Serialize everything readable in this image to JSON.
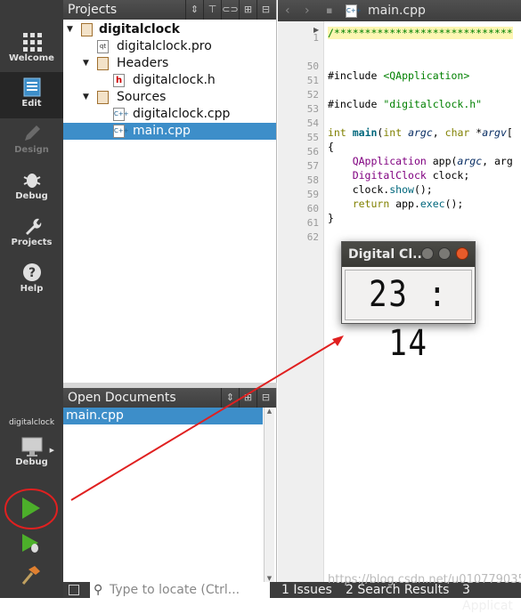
{
  "modes": [
    {
      "label": "Welcome",
      "icon": "grid-icon",
      "state": "normal"
    },
    {
      "label": "Edit",
      "icon": "document-icon",
      "state": "selected"
    },
    {
      "label": "Design",
      "icon": "pencil-icon",
      "state": "disabled"
    },
    {
      "label": "Debug",
      "icon": "bug-icon",
      "state": "normal"
    },
    {
      "label": "Projects",
      "icon": "wrench-icon",
      "state": "normal"
    },
    {
      "label": "Help",
      "icon": "help-icon",
      "state": "normal"
    }
  ],
  "kit": {
    "project": "digitalclock",
    "mode": "Debug"
  },
  "projects_panel": {
    "title": "Projects"
  },
  "tree": {
    "project": "digitalclock",
    "pro_file": "digitalclock.pro",
    "headers": "Headers",
    "header_file": "digitalclock.h",
    "sources": "Sources",
    "source_file": "digitalclock.cpp",
    "main_file": "main.cpp"
  },
  "open_documents": {
    "title": "Open Documents",
    "items": [
      "main.cpp"
    ]
  },
  "editor": {
    "tab_title": "main.cpp",
    "lines": [
      {
        "num": "1",
        "text": "/*****************************"
      },
      {
        "num": "50",
        "text": ""
      },
      {
        "num": "51",
        "text": "#include <QApplication>"
      },
      {
        "num": "52",
        "text": ""
      },
      {
        "num": "53",
        "text": "#include \"digitalclock.h\""
      },
      {
        "num": "54",
        "text": ""
      },
      {
        "num": "55",
        "text": "int main(int argc, char *argv["
      },
      {
        "num": "56",
        "text": "{"
      },
      {
        "num": "57",
        "text": "    QApplication app(argc, arg"
      },
      {
        "num": "58",
        "text": "    DigitalClock clock;"
      },
      {
        "num": "59",
        "text": "    clock.show();"
      },
      {
        "num": "60",
        "text": "    return app.exec();"
      },
      {
        "num": "61",
        "text": "}"
      },
      {
        "num": "62",
        "text": ""
      }
    ]
  },
  "clock_window": {
    "title": "Digital Cl...",
    "time": "23 : 14"
  },
  "statusbar": {
    "locator_placeholder": "Type to locate (Ctrl...",
    "panes": [
      "1  Issues",
      "2  Search Results",
      "3  Applicat"
    ],
    "watermark": "https://blog.csdn.net/u010779035"
  },
  "colors": {
    "selection": "#3d8ec9",
    "modebar": "#3a3a3a",
    "annotation": "#e02020"
  }
}
